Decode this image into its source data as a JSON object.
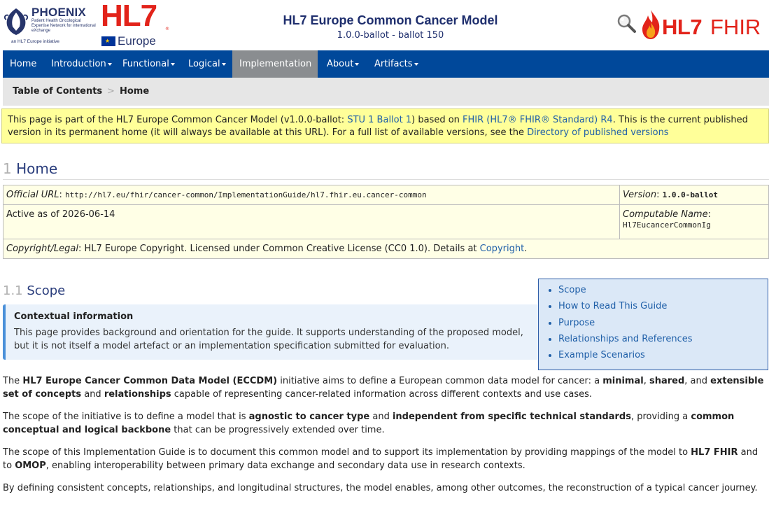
{
  "header": {
    "phoenix_logo": {
      "title": "PHOENIX",
      "subtitle": "Patient Health Oncological Expertise Network for international eXchange",
      "initiative": "an HL7 Europe initiative"
    },
    "hl7_europe_logo": {
      "hl7": "HL7",
      "reg": "®",
      "europe": "Europe"
    },
    "title": "HL7 Europe Common Cancer Model",
    "subtitle": "1.0.0-ballot - ballot 150",
    "fhir_logo": {
      "hl7": "HL7",
      "fhir": "FHIR"
    },
    "icons": {
      "search": "magnifier-search-icon",
      "flame": "fhir-flame-icon"
    }
  },
  "navbar": {
    "items": [
      {
        "label": "Home",
        "dropdown": false
      },
      {
        "label": "Introduction",
        "dropdown": true
      },
      {
        "label": "Functional",
        "dropdown": true
      },
      {
        "label": "Logical",
        "dropdown": true
      },
      {
        "label": "Implementation",
        "dropdown": true,
        "active": true
      },
      {
        "label": "About",
        "dropdown": true
      },
      {
        "label": "Artifacts",
        "dropdown": true
      }
    ]
  },
  "breadcrumb": {
    "toc": "Table of Contents",
    "separator": ">",
    "current": "Home"
  },
  "notice": {
    "t1": "This page is part of the HL7 Europe Common Cancer Model (v1.0.0-ballot: ",
    "l1": "STU 1 Ballot 1",
    "t2": ") based on ",
    "l2": "FHIR (HL7® FHIR® Standard) R4",
    "t3": ". This is the current published version in its permanent home (it will always be available at this URL). For a full list of available versions, see the ",
    "l3": "Directory of published versions"
  },
  "page": {
    "heading_number": "1",
    "heading": "Home",
    "meta": {
      "url_label": "Official URL",
      "url_value": "http://hl7.eu/fhir/cancer-common/ImplementationGuide/hl7.fhir.eu.cancer-common",
      "version_label": "Version",
      "version_value": "1.0.0-ballot",
      "active": "Active as of 2026-06-14",
      "comp_label": "Computable Name",
      "comp_value": "Hl7EucancerCommonIg",
      "copyright_label": "Copyright/Legal",
      "copyright_text": ": HL7 Europe Copyright. Licensed under Common Creative License (CC0 1.0). Details at ",
      "copyright_link": "Copyright",
      "copyright_end": "."
    }
  },
  "scope": {
    "number": "1.1",
    "heading": "Scope",
    "context_title": "Contextual information",
    "context_body": "This page provides background and orientation for the guide. It supports understanding of the proposed model, but it is not itself a model artefact or an implementation specification submitted for evaluation."
  },
  "toc_box": [
    "Scope",
    "How to Read This Guide",
    "Purpose",
    "Relationships and References",
    "Example Scenarios"
  ],
  "paragraphs": {
    "p1": {
      "a": "The ",
      "b": "HL7 Europe Cancer Common Data Model (ECCDM)",
      "c": " initiative aims to define a European common data model for cancer: a ",
      "d": "minimal",
      "e": ", ",
      "f": "shared",
      "g": ", and ",
      "h": "extensible set of concepts",
      "i": " and ",
      "j": "relationships",
      "k": " capable of representing cancer-related information across different contexts and use cases."
    },
    "p2": {
      "a": "The scope of the initiative is to define a model that is ",
      "b": "agnostic to cancer type",
      "c": " and ",
      "d": "independent from specific technical standards",
      "e": ", providing a ",
      "f": "common conceptual and logical backbone",
      "g": " that can be progressively extended over time."
    },
    "p3": {
      "a": "The scope of this Implementation Guide is to document this common model and to support its implementation by providing mappings of the model to ",
      "b": "HL7 FHIR",
      "c": " and to ",
      "d": "OMOP",
      "e": ", enabling interoperability between primary data exchange and secondary data use in research contexts."
    },
    "p4": "By defining consistent concepts, relationships, and longitudinal structures, the model enables, among other outcomes, the reconstruction of a typical cancer journey."
  },
  "colors": {
    "nav_bg": "#00489a",
    "nav_active": "#8a8d90",
    "notice_bg": "#ffff99",
    "link": "#1f5fa8",
    "heading": "#2a3d7c",
    "hl7_red": "#e2231a"
  }
}
